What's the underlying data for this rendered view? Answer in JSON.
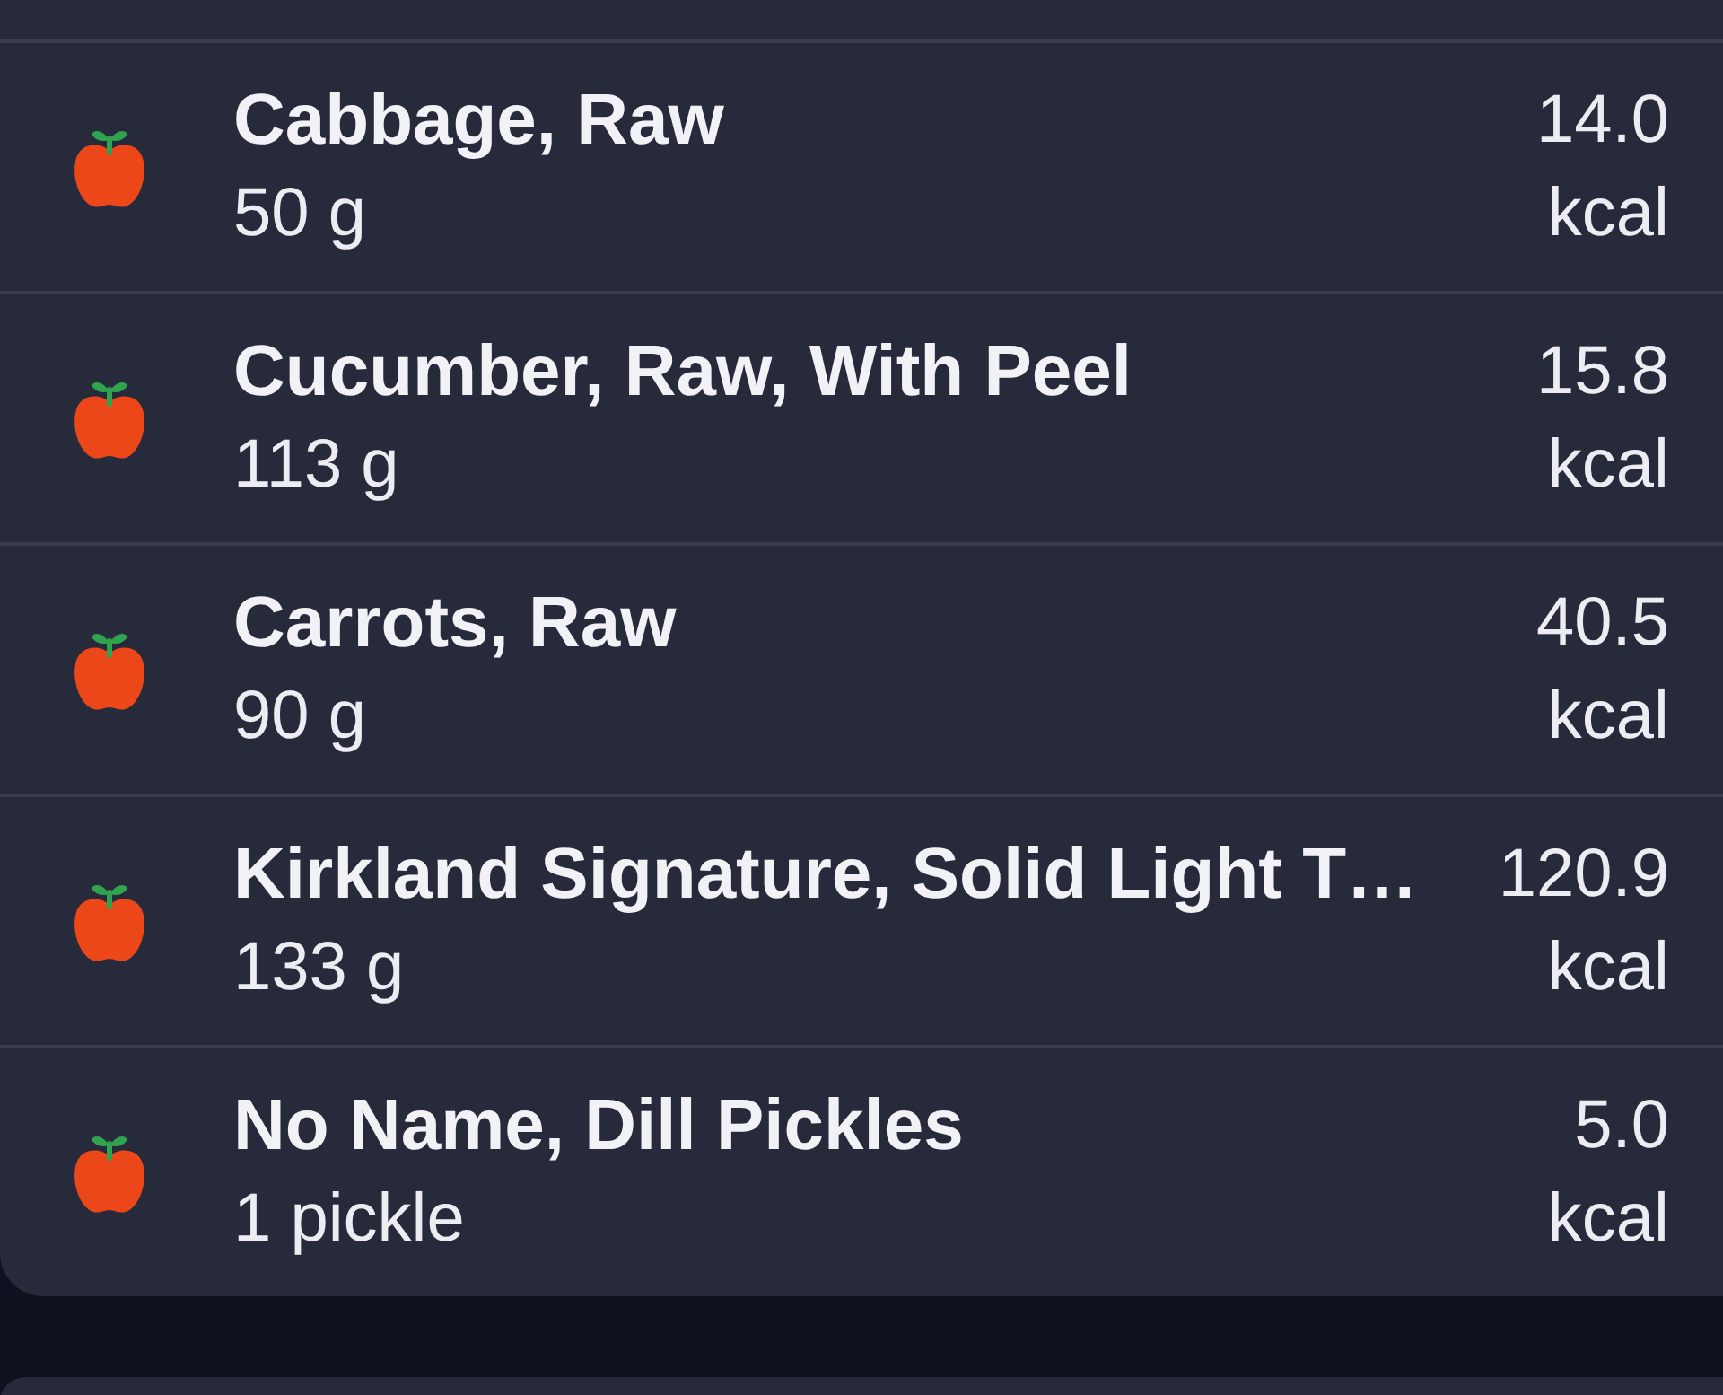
{
  "food_log": {
    "items": [
      {
        "name": "Cabbage, Raw",
        "amount": "50 g",
        "calories": "14.0",
        "unit": "kcal"
      },
      {
        "name": "Cucumber, Raw, With Peel",
        "amount": "113 g",
        "calories": "15.8",
        "unit": "kcal"
      },
      {
        "name": "Carrots, Raw",
        "amount": "90 g",
        "calories": "40.5",
        "unit": "kcal"
      },
      {
        "name": "Kirkland Signature, Solid Light T…",
        "amount": "133 g",
        "calories": "120.9",
        "unit": "kcal"
      },
      {
        "name": "No Name, Dill Pickles",
        "amount": "1 pickle",
        "calories": "5.0",
        "unit": "kcal"
      }
    ]
  }
}
